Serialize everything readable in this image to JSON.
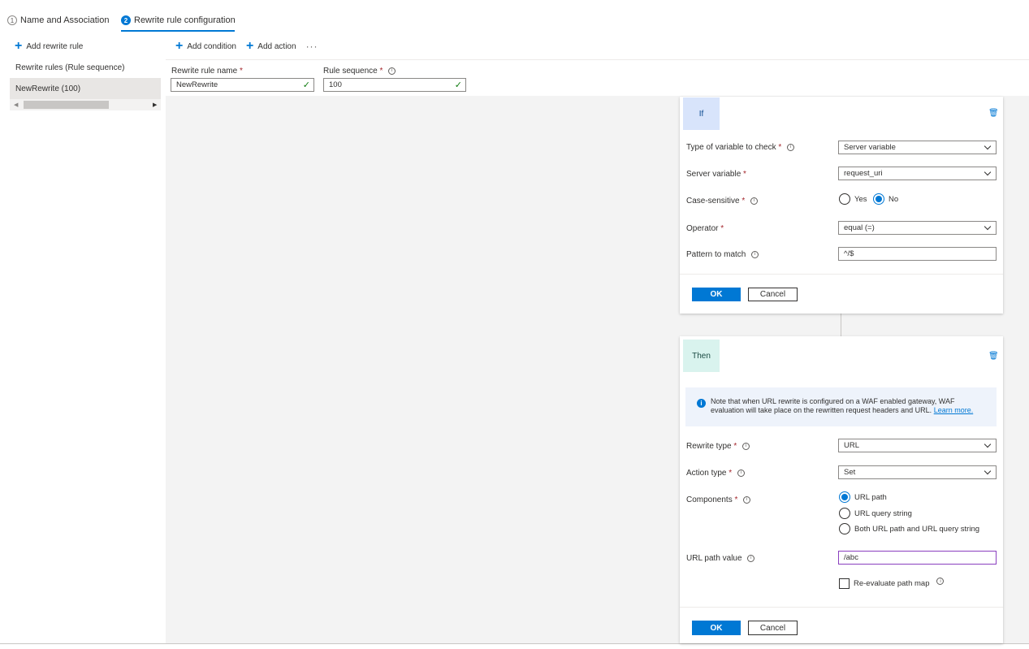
{
  "tabs": [
    {
      "num": "1",
      "label": "Name and Association"
    },
    {
      "num": "2",
      "label": "Rewrite rule configuration"
    }
  ],
  "left_panel": {
    "add_rule_label": "Add rewrite rule",
    "title": "Rewrite rules (Rule sequence)",
    "rules": [
      "NewRewrite (100)"
    ]
  },
  "toolbar": {
    "add_condition": "Add condition",
    "add_action": "Add action",
    "more": "···"
  },
  "rule_form": {
    "name_label": "Rewrite rule name",
    "name_value": "NewRewrite",
    "sequence_label": "Rule sequence",
    "sequence_value": "100",
    "required_mark": "*"
  },
  "if_card": {
    "badge": "If",
    "type_label": "Type of variable to check",
    "type_value": "Server variable",
    "server_var_label": "Server variable",
    "server_var_value": "request_uri",
    "case_label": "Case-sensitive",
    "case_yes": "Yes",
    "case_no": "No",
    "case_selected": "No",
    "operator_label": "Operator",
    "operator_value": "equal (=)",
    "pattern_label": "Pattern to match",
    "pattern_value": "^/$",
    "ok": "OK",
    "cancel": "Cancel"
  },
  "then_card": {
    "badge": "Then",
    "note_text": "Note that when URL rewrite is configured on a WAF enabled gateway, WAF evaluation will take place on the rewritten request headers and URL.",
    "note_link": "Learn more.",
    "rewrite_type_label": "Rewrite type",
    "rewrite_type_value": "URL",
    "action_type_label": "Action type",
    "action_type_value": "Set",
    "components_label": "Components",
    "components_options": [
      "URL path",
      "URL query string",
      "Both URL path and URL query string"
    ],
    "components_selected": "URL path",
    "url_path_label": "URL path value",
    "url_path_value": "/abc",
    "reevaluate_label": "Re-evaluate path map",
    "ok": "OK",
    "cancel": "Cancel"
  },
  "colors": {
    "accent": "#0078d4",
    "if_badge_bg": "#d8e4fb",
    "then_badge_bg": "#d9f3ee",
    "focus_border": "#8a3fbf",
    "valid_check": "#107c10"
  },
  "icons": [
    "plus-icon",
    "info-icon",
    "check-icon",
    "trash-icon",
    "chevron-down-icon",
    "caret-left-icon",
    "caret-right-icon"
  ]
}
